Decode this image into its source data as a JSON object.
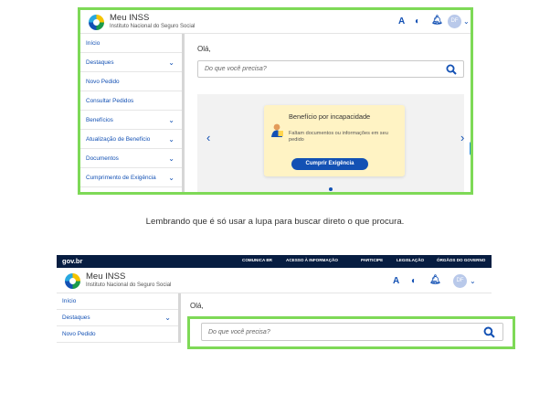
{
  "top_screen": {
    "brand": {
      "title": "Meu INSS",
      "subtitle": "Instituto Nacional do Seguro Social"
    },
    "header_icons": {
      "contrast_label": "A",
      "contrast_icon": "half-circle-icon",
      "bell_icon": "bell-icon",
      "avatar_initials": "DF",
      "avatar_chevron": "chevron-down-icon"
    },
    "sidebar_items": [
      {
        "label": "Início",
        "has_chevron": false
      },
      {
        "label": "Destaques",
        "has_chevron": true
      },
      {
        "label": "Novo Pedido",
        "has_chevron": false
      },
      {
        "label": "Consultar Pedidos",
        "has_chevron": false
      },
      {
        "label": "Benefícios",
        "has_chevron": true
      },
      {
        "label": "Atualização de Benefício",
        "has_chevron": true
      },
      {
        "label": "Documentos",
        "has_chevron": true
      },
      {
        "label": "Cumprimento de Exigência",
        "has_chevron": true
      }
    ],
    "greeting": "Olá,",
    "search_placeholder": "Do que você precisa?",
    "card": {
      "title": "Benefício por incapacidade",
      "body": "Faltam documentos ou informações em seu pedido",
      "button": "Cumprir Exigência"
    },
    "carousel": {
      "prev": "‹",
      "next": "›"
    }
  },
  "caption": "Lembrando que é só usar a lupa para buscar direto o que procura.",
  "bottom_screen": {
    "gov_logo": "gov.br",
    "gov_links": [
      "COMUNICA BR",
      "ACESSO À INFORMAÇÃO",
      "PARTICIPE",
      "LEGISLAÇÃO",
      "ÓRGÃOS DO GOVERNO"
    ],
    "brand": {
      "title": "Meu INSS",
      "subtitle": "Instituto Nacional do Seguro Social"
    },
    "header_icons": {
      "contrast_label": "A",
      "avatar_initials": "DF"
    },
    "sidebar_items": [
      {
        "label": "Início",
        "has_chevron": false
      },
      {
        "label": "Destaques",
        "has_chevron": true
      },
      {
        "label": "Novo Pedido",
        "has_chevron": false
      }
    ],
    "greeting": "Olá,",
    "search_placeholder": "Do que você precisa?"
  },
  "colors": {
    "frame": "#7ed957",
    "primary": "#1351b4",
    "gov_bar": "#071d41",
    "card_bg": "#fff3c4"
  }
}
